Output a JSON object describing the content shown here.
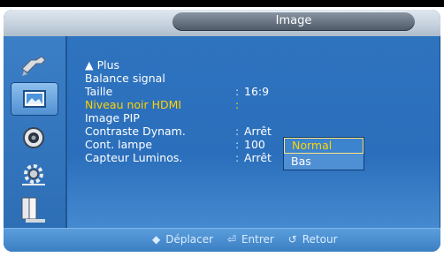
{
  "window": {
    "title": "Image"
  },
  "sidebar": {
    "items": [
      {
        "icon": "input-icon"
      },
      {
        "icon": "picture-icon",
        "active": true
      },
      {
        "icon": "sound-icon"
      },
      {
        "icon": "setup-icon"
      },
      {
        "icon": "multi-control-icon"
      }
    ]
  },
  "menu": {
    "more_label": "▲ Plus",
    "rows": [
      {
        "label": "Balance signal",
        "value": ""
      },
      {
        "label": "Taille",
        "value": "16:9"
      },
      {
        "label": "Niveau noir HDMI",
        "value": ""
      },
      {
        "label": "Image PIP",
        "value": ""
      },
      {
        "label": "Contraste Dynam.",
        "value": "Arrêt"
      },
      {
        "label": "Cont. lampe",
        "value": "100"
      },
      {
        "label": "Capteur Luminos.",
        "value": "Arrêt"
      }
    ],
    "separator": ":"
  },
  "dropdown": {
    "options": [
      {
        "label": "Normal",
        "selected": true
      },
      {
        "label": "Bas",
        "selected": false
      }
    ]
  },
  "hints": {
    "move_icon": "◆",
    "move_label": "Déplacer",
    "enter_icon": "⏎",
    "enter_label": "Entrer",
    "return_icon": "↺",
    "return_label": "Retour"
  },
  "colors": {
    "highlight": "#ffd200",
    "panel": "#2f74bf"
  }
}
